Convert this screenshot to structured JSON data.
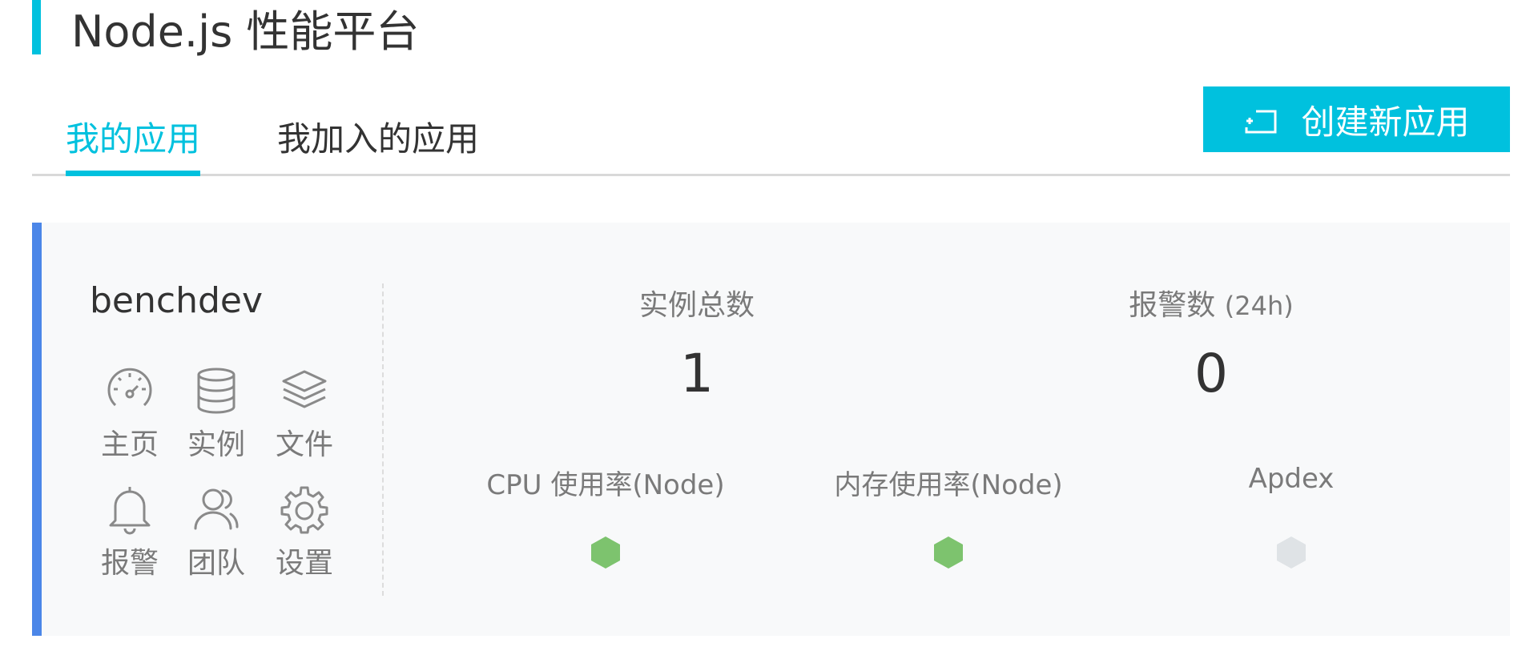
{
  "header": {
    "title": "Node.js 性能平台",
    "accent_color": "#00c1de"
  },
  "tabs": [
    {
      "label": "我的应用",
      "active": true
    },
    {
      "label": "我加入的应用",
      "active": false
    }
  ],
  "create_button": {
    "label": "创建新应用",
    "icon": "add-window-icon"
  },
  "app_card": {
    "name": "benchdev",
    "accent_color": "#4b86e8",
    "nav": [
      {
        "label": "主页",
        "icon": "dashboard-gauge-icon"
      },
      {
        "label": "实例",
        "icon": "database-icon"
      },
      {
        "label": "文件",
        "icon": "layers-icon"
      },
      {
        "label": "报警",
        "icon": "bell-icon"
      },
      {
        "label": "团队",
        "icon": "team-icon"
      },
      {
        "label": "设置",
        "icon": "gear-icon"
      }
    ],
    "stats": {
      "instances": {
        "label": "实例总数",
        "value": "1"
      },
      "alerts": {
        "label": "报警数",
        "sub": "(24h)",
        "value": "0"
      }
    },
    "metrics": [
      {
        "label": "CPU 使用率(Node)",
        "status_color": "#7dc36e"
      },
      {
        "label": "内存使用率(Node)",
        "status_color": "#7dc36e"
      },
      {
        "label": "Apdex",
        "status_color": "#dfe3e6"
      }
    ]
  }
}
